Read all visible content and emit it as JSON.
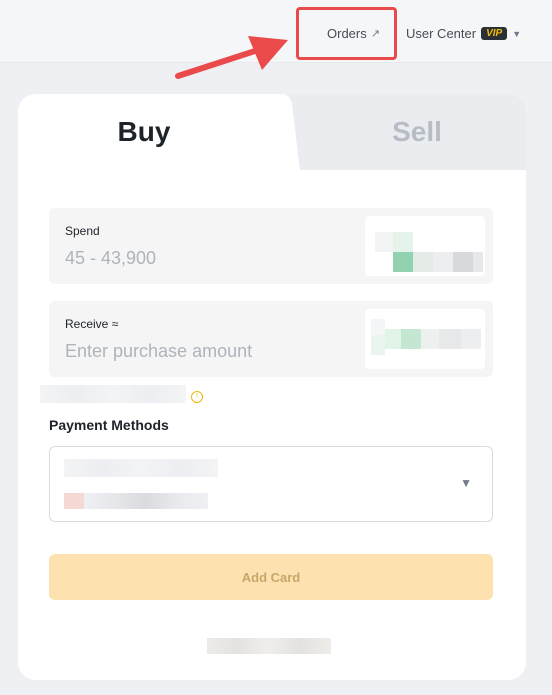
{
  "header": {
    "orders_label": "Orders",
    "orders_ext_icon": "↗",
    "user_center_label": "User Center",
    "vip_badge": "VIP",
    "user_center_caret": "▼"
  },
  "tabs": {
    "buy_label": "Buy",
    "sell_label": "Sell",
    "active": "Buy"
  },
  "spend": {
    "label": "Spend",
    "placeholder": "45 - 43,900"
  },
  "receive": {
    "label": "Receive ≈",
    "placeholder": "Enter purchase amount"
  },
  "payment": {
    "label": "Payment Methods",
    "caret": "▼"
  },
  "add_card": {
    "label": "Add Card"
  },
  "colors": {
    "annotation_red": "#ea4a4a",
    "brand_yellow": "#f0b90b",
    "button_disabled": "#fde2b0"
  }
}
